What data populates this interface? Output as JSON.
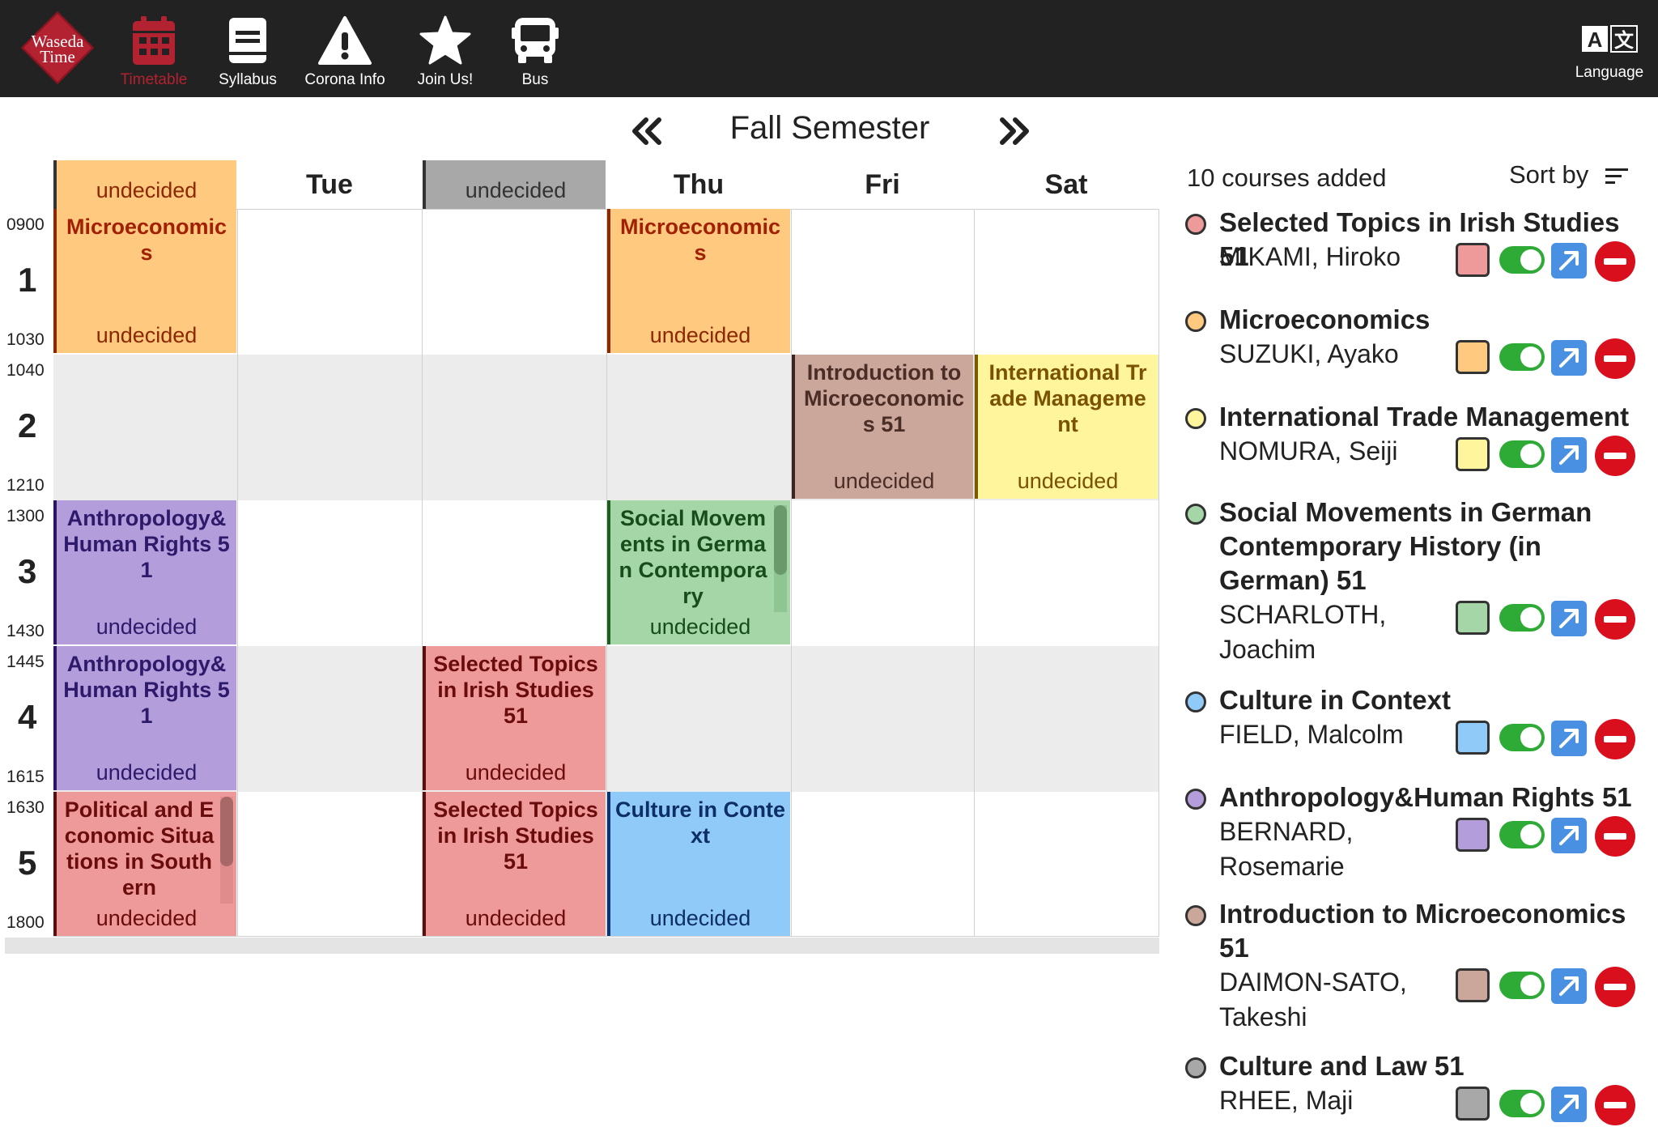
{
  "header": {
    "logo_text_1": "Waseda",
    "logo_text_2": "Time",
    "nav": [
      {
        "label": "Timetable",
        "icon": "calendar-icon",
        "active": true
      },
      {
        "label": "Syllabus",
        "icon": "book-icon"
      },
      {
        "label": "Corona Info",
        "icon": "warning-icon"
      },
      {
        "label": "Join Us!",
        "icon": "star-icon"
      },
      {
        "label": "Bus",
        "icon": "bus-icon"
      }
    ],
    "language_label": "Language",
    "colors": {
      "bar": "#222222",
      "accent": "#b22230"
    }
  },
  "semester": {
    "title": "Fall Semester",
    "prev_icon": "double-chevron-left-icon",
    "next_icon": "double-chevron-right-icon"
  },
  "timetable": {
    "days": [
      "undecided",
      "Tue",
      "undecided",
      "Thu",
      "Fri",
      "Sat"
    ],
    "periods": [
      {
        "num": "1",
        "start": "0900",
        "end": "1030"
      },
      {
        "num": "2",
        "start": "1040",
        "end": "1210"
      },
      {
        "num": "3",
        "start": "1300",
        "end": "1430"
      },
      {
        "num": "4",
        "start": "1445",
        "end": "1615"
      },
      {
        "num": "5",
        "start": "1630",
        "end": "1800"
      }
    ],
    "cells": {
      "mon1": {
        "title": "Microeconomic s",
        "loc": "undecided"
      },
      "thu1": {
        "title": "Microeconomic s",
        "loc": "undecided"
      },
      "fri2": {
        "title": "Introduction to Microeconomic s 51",
        "loc": "undecided"
      },
      "sat2": {
        "title": "International Trade Management",
        "loc": "undecided"
      },
      "mon3": {
        "title": "Anthropology& Human Rights 51",
        "loc": "undecided"
      },
      "thu3": {
        "title": "Social Movements in German Contemporary",
        "loc": "undecided"
      },
      "mon4": {
        "title": "Anthropology& Human Rights 51",
        "loc": "undecided"
      },
      "wed4": {
        "title": "Selected Topics in Irish Studies 51",
        "loc": "undecided"
      },
      "mon5": {
        "title": "Political and Economic Situations in Southern",
        "loc": "undecided"
      },
      "wed5": {
        "title": "Selected Topics in Irish Studies 51",
        "loc": "undecided"
      },
      "thu5": {
        "title": "Culture in Context",
        "loc": "undecided"
      }
    }
  },
  "course_list": {
    "count_text": "10 courses added",
    "sort_label": "Sort by",
    "items": [
      {
        "title": "Selected Topics in Irish Studies 51",
        "instructor": "MIKAMI, Hiroko",
        "color": "#ef9a9a"
      },
      {
        "title": "Microeconomics",
        "instructor": "SUZUKI, Ayako",
        "color": "#ffca80"
      },
      {
        "title": "International Trade Management",
        "instructor": "NOMURA, Seiji",
        "color": "#fff59d"
      },
      {
        "title": "Social Movements in German Contemporary History (in German) 51",
        "instructor": "SCHARLOTH, Joachim",
        "color": "#a5d6a7"
      },
      {
        "title": "Culture in Context",
        "instructor": "FIELD, Malcolm",
        "color": "#90caf9"
      },
      {
        "title": "Anthropology&Human Rights 51",
        "instructor": "BERNARD, Rosemarie",
        "color": "#b39ddb"
      },
      {
        "title": "Introduction to Microeconomics 51",
        "instructor": "DAIMON-SATO, Takeshi",
        "color": "#cba69a"
      },
      {
        "title": "Culture and Law 51",
        "instructor": "RHEE, Maji",
        "color": "#a8a8a8"
      }
    ]
  }
}
